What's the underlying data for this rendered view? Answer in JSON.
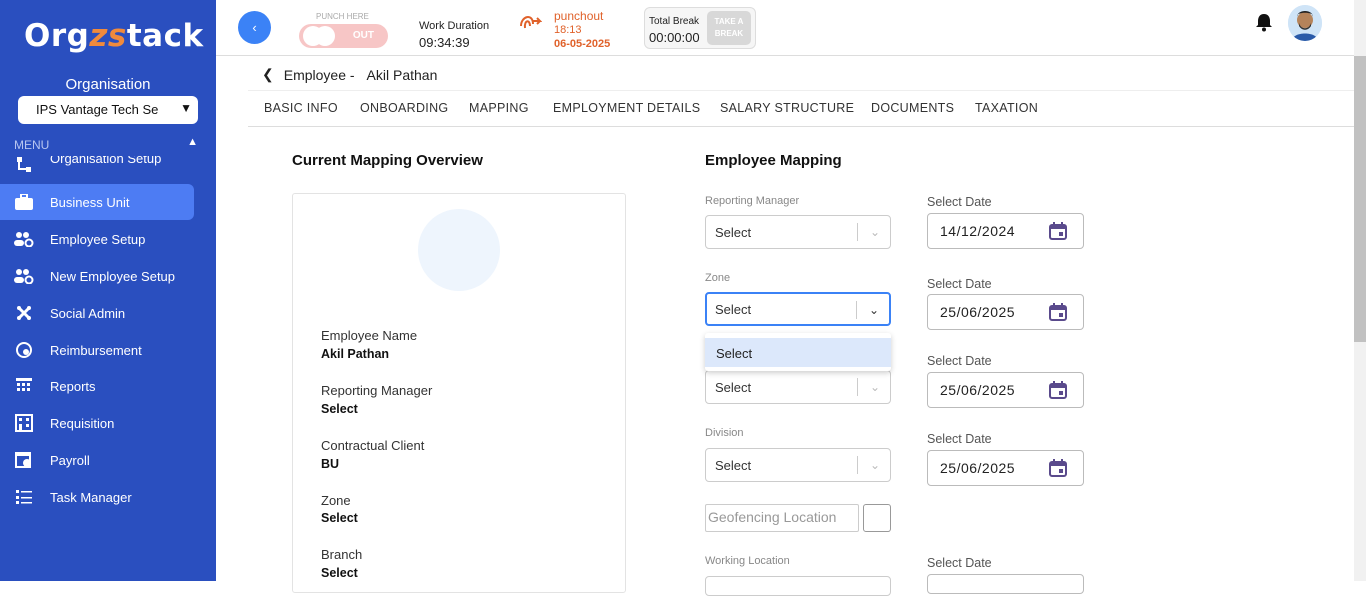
{
  "app": {
    "logo_pre": "Org",
    "logo_mid": "zs",
    "logo_post": "tack"
  },
  "sidebar": {
    "org_label": "Organisation",
    "org_value": "IPS Vantage Tech Se",
    "menu_label": "MENU",
    "items": [
      {
        "label": "Organisation Setup",
        "icon": "sitemap-icon"
      },
      {
        "label": "Business Unit",
        "icon": "briefcase-icon",
        "active": true
      },
      {
        "label": "Employee Setup",
        "icon": "users-gear-icon"
      },
      {
        "label": "New Employee Setup",
        "icon": "users-gear-icon"
      },
      {
        "label": "Social Admin",
        "icon": "joomla-icon"
      },
      {
        "label": "Reimbursement",
        "icon": "money-cycle-icon"
      },
      {
        "label": "Reports",
        "icon": "calendar-grid-icon"
      },
      {
        "label": "Requisition",
        "icon": "building-icon"
      },
      {
        "label": "Payroll",
        "icon": "payroll-icon"
      },
      {
        "label": "Task Manager",
        "icon": "list-icon"
      }
    ]
  },
  "topbar": {
    "punch_here": "PUNCH HERE",
    "punch_state": "OUT",
    "work_duration_label": "Work Duration",
    "work_duration": "09:34:39",
    "punchout_label": "punchout",
    "punchout_time": "18:13",
    "punchout_date": "06-05-2025",
    "total_break_label": "Total Break",
    "total_break": "00:00:00",
    "take_break_1": "TAKE A",
    "take_break_2": "BREAK"
  },
  "breadcrumb": {
    "section": "Employee -",
    "name": "Akil Pathan"
  },
  "tabs": [
    "BASIC INFO",
    "ONBOARDING",
    "MAPPING",
    "EMPLOYMENT DETAILS",
    "SALARY STRUCTURE",
    "DOCUMENTS",
    "TAXATION"
  ],
  "overview": {
    "title": "Current Mapping Overview",
    "rows": [
      {
        "label": "Employee Name",
        "value": "Akil Pathan"
      },
      {
        "label": "Reporting Manager",
        "value": "Select"
      },
      {
        "label": "Contractual Client",
        "value": "BU"
      },
      {
        "label": "Zone",
        "value": "Select"
      },
      {
        "label": "Branch",
        "value": "Select"
      }
    ]
  },
  "mapping": {
    "title": "Employee Mapping",
    "select_date_label": "Select Date",
    "reporting_manager_label": "Reporting Manager",
    "zone_label": "Zone",
    "division_label": "Division",
    "working_location_label": "Working Location",
    "select_placeholder": "Select",
    "dropdown_option": "Select",
    "geofencing_placeholder": "Geofencing Location",
    "dates": [
      "14/12/2024",
      "25/06/2025",
      "25/06/2025",
      "25/06/2025"
    ]
  },
  "colors": {
    "sidebar": "#2a4fbf",
    "active": "#4d7cf3",
    "accent": "#3b82f6",
    "punch": "#e0622b"
  }
}
